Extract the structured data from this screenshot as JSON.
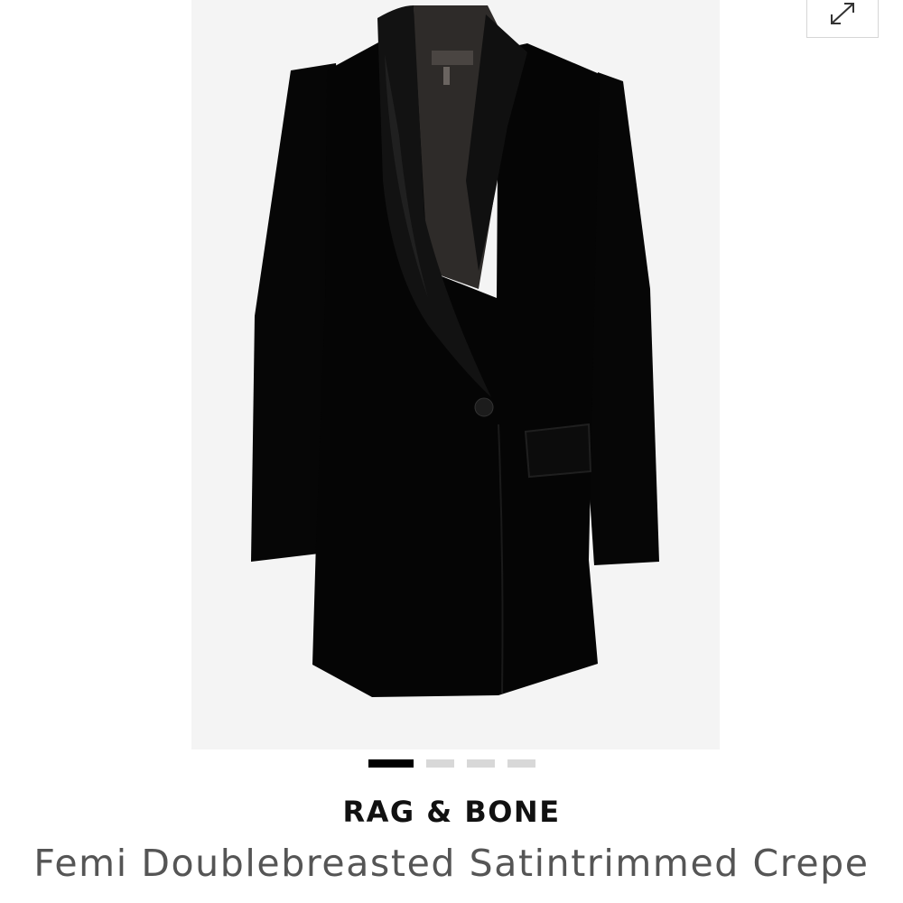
{
  "product": {
    "brand": "RAG & BONE",
    "name_line1": "Femi Doublebreasted Satintrimmed Crepe",
    "image_alt": "Black blazer dress with satin shawl lapel"
  },
  "gallery": {
    "slide_count": 4,
    "active_slide": 1,
    "background_color": "#f4f4f4",
    "expand_icon": "expand-arrows-icon"
  },
  "colors": {
    "garment": "#050505",
    "lining": "#2e2b29",
    "active_dot": "#000000",
    "inactive_dot": "#d8d8d8",
    "brand_text": "#111111",
    "name_text": "#555555"
  }
}
